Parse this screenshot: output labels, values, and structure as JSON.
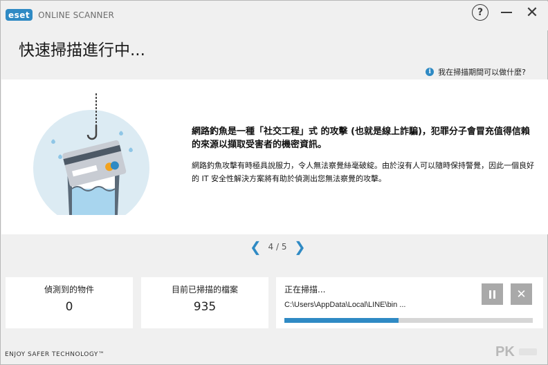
{
  "app": {
    "logo_badge": "eset",
    "logo_text": "ONLINE SCANNER",
    "help_icon": "?",
    "close_icon": "✕"
  },
  "header": {
    "title": "快速掃描進行中...",
    "help_link": "我在掃描期間可以做什麼?"
  },
  "tip": {
    "headline": "網路釣魚是一種「社交工程」式 的攻擊 (也就是線上詐騙)，犯罪分子會冒充值得信賴的來源以擷取受害者的機密資訊。",
    "body": "網路釣魚攻擊有時極具說服力，令人無法察覺絲毫破綻。由於沒有人可以隨時保持警覺，因此一個良好的 IT 安全性解決方案將有助於偵測出您無法察覺的攻擊。"
  },
  "pager": {
    "text": "4 / 5",
    "prev": "❮",
    "next": "❯"
  },
  "stats": {
    "detected_label": "偵測到的物件",
    "detected_value": "0",
    "scanned_label": "目前已掃描的檔案",
    "scanned_value": "935"
  },
  "scan": {
    "label": "正在掃描...",
    "path": "C:\\Users\\AppData\\Local\\LINE\\bin ...",
    "progress": 0.46,
    "stop_icon": "✕"
  },
  "footer": {
    "tagline": "ENJOY SAFER TECHNOLOGY™"
  },
  "colors": {
    "accent": "#2f8ac4",
    "window_bg": "#f0f0f0",
    "button_gray": "#a9a9a9"
  }
}
